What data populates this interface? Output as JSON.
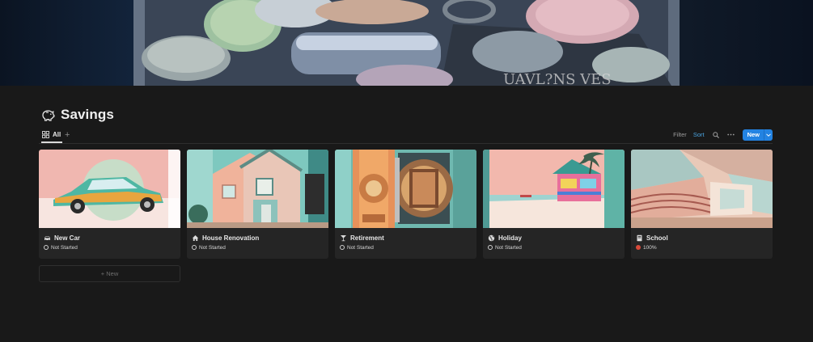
{
  "page": {
    "title": "Savings",
    "title_icon": "piggy-bank-icon"
  },
  "views": {
    "tabs": [
      {
        "label": "All",
        "icon": "gallery-grid-icon",
        "active": true
      }
    ],
    "add_view_label": "+"
  },
  "toolbar": {
    "filter_label": "Filter",
    "sort_label": "Sort",
    "search_icon": "search-icon",
    "more_icon": "more-horizontal-icon",
    "new_label": "New",
    "new_caret_icon": "chevron-down-icon",
    "accent_color": "#2383e2",
    "sort_color": "#4aa3df"
  },
  "cards": [
    {
      "title": "New Car",
      "icon": "car-icon",
      "status": "Not Started",
      "status_style": "ring"
    },
    {
      "title": "House Renovation",
      "icon": "house-icon",
      "status": "Not Started",
      "status_style": "ring"
    },
    {
      "title": "Retirement",
      "icon": "cocktail-glass-icon",
      "status": "Not Started",
      "status_style": "ring"
    },
    {
      "title": "Holiday",
      "icon": "globe-icon",
      "status": "Not Started",
      "status_style": "ring"
    },
    {
      "title": "School",
      "icon": "book-icon",
      "status": "100%",
      "status_style": "dot",
      "status_color": "#d94a3a"
    }
  ],
  "new_card": {
    "label": "+ New"
  }
}
